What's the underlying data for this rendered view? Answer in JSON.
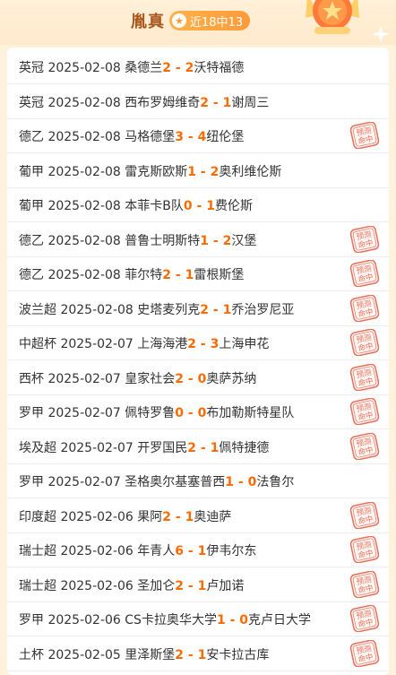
{
  "header": {
    "name": "胤真",
    "badge_text": "近18中13",
    "badge_color": "#ff9a3a",
    "accent_color": "#a8571c"
  },
  "matches": [
    {
      "league": "英冠",
      "date": "2025-02-08",
      "home": "桑德兰",
      "home_score": "2",
      "sep": "-",
      "away_score": "2",
      "away": "沃特福德",
      "hit": false
    },
    {
      "league": "英冠",
      "date": "2025-02-08",
      "home": "西布罗姆维奇",
      "home_score": "2",
      "sep": "-",
      "away_score": "1",
      "away": "谢周三",
      "hit": false
    },
    {
      "league": "德乙",
      "date": "2025-02-08",
      "home": "马格德堡",
      "home_score": "3",
      "sep": "-",
      "away_score": "4",
      "away": "纽伦堡",
      "hit": true
    },
    {
      "league": "葡甲",
      "date": "2025-02-08",
      "home": "雷克斯欧斯",
      "home_score": "1",
      "sep": "-",
      "away_score": "2",
      "away": "奥利维伦斯",
      "hit": false
    },
    {
      "league": "葡甲",
      "date": "2025-02-08",
      "home": "本菲卡B队",
      "home_score": "0",
      "sep": "-",
      "away_score": "1",
      "away": "费伦斯",
      "hit": false
    },
    {
      "league": "德乙",
      "date": "2025-02-08",
      "home": "普鲁士明斯特",
      "home_score": "1",
      "sep": "-",
      "away_score": "2",
      "away": "汉堡",
      "hit": true
    },
    {
      "league": "德乙",
      "date": "2025-02-08",
      "home": "菲尔特",
      "home_score": "2",
      "sep": "-",
      "away_score": "1",
      "away": "雷根斯堡",
      "hit": true
    },
    {
      "league": "波兰超",
      "date": "2025-02-08",
      "home": "史塔麦列克",
      "home_score": "2",
      "sep": "-",
      "away_score": "1",
      "away": "乔治罗尼亚",
      "hit": true
    },
    {
      "league": "中超杯",
      "date": "2025-02-07",
      "home": "上海海港",
      "home_score": "2",
      "sep": "-",
      "away_score": "3",
      "away": "上海申花",
      "hit": true
    },
    {
      "league": "西杯",
      "date": "2025-02-07",
      "home": "皇家社会",
      "home_score": "2",
      "sep": "-",
      "away_score": "0",
      "away": "奥萨苏纳",
      "hit": true
    },
    {
      "league": "罗甲",
      "date": "2025-02-07",
      "home": "佩特罗鲁",
      "home_score": "0",
      "sep": "-",
      "away_score": "0",
      "away": "布加勒斯特星队",
      "hit": true
    },
    {
      "league": "埃及超",
      "date": "2025-02-07",
      "home": "开罗国民",
      "home_score": "2",
      "sep": "-",
      "away_score": "1",
      "away": "佩特捷德",
      "hit": true
    },
    {
      "league": "罗甲",
      "date": "2025-02-07",
      "home": "圣格奥尔基塞普西",
      "home_score": "1",
      "sep": "-",
      "away_score": "0",
      "away": "法鲁尔",
      "hit": false
    },
    {
      "league": "印度超",
      "date": "2025-02-06",
      "home": "果阿",
      "home_score": "2",
      "sep": "-",
      "away_score": "1",
      "away": "奥迪萨",
      "hit": true
    },
    {
      "league": "瑞士超",
      "date": "2025-02-06",
      "home": "年青人",
      "home_score": "6",
      "sep": "-",
      "away_score": "1",
      "away": "伊韦尔东",
      "hit": true
    },
    {
      "league": "瑞士超",
      "date": "2025-02-06",
      "home": "圣加仑",
      "home_score": "2",
      "sep": "-",
      "away_score": "1",
      "away": "卢加诺",
      "hit": true
    },
    {
      "league": "罗甲",
      "date": "2025-02-06",
      "home": "CS卡拉奥华大学",
      "home_score": "1",
      "sep": "-",
      "away_score": "0",
      "away": "克卢日大学",
      "hit": true
    },
    {
      "league": "土杯",
      "date": "2025-02-05",
      "home": "里泽斯堡",
      "home_score": "2",
      "sep": "-",
      "away_score": "1",
      "away": "安卡拉古库",
      "hit": true
    }
  ],
  "stamp": {
    "line1": "预测",
    "line2": "命中",
    "color": "#e8705a"
  },
  "score_color": "#ff6a00"
}
